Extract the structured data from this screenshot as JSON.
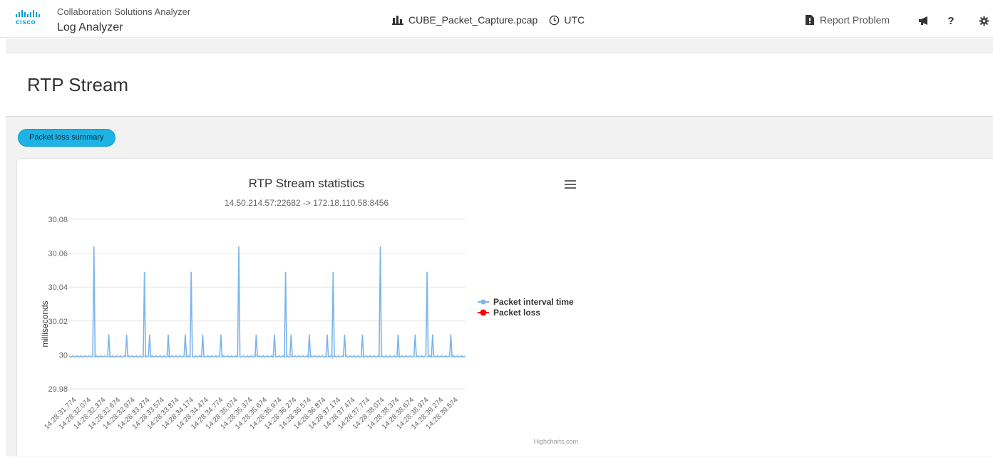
{
  "header": {
    "brand": "cisco",
    "app_title": "Collaboration Solutions Analyzer",
    "app_subtitle": "Log Analyzer",
    "file_name": "CUBE_Packet_Capture.pcap",
    "timezone": "UTC",
    "report_label": "Report Problem",
    "help_label": "?"
  },
  "page": {
    "title": "RTP Stream",
    "summary_button": "Packet loss summary"
  },
  "colors": {
    "accent": "#1fb3e5",
    "series_interval": "#7cb5ec",
    "series_loss": "#ff0000"
  },
  "icons": [
    "bar-chart-icon",
    "clock-icon",
    "report-icon",
    "megaphone-icon",
    "help-icon",
    "gear-icon",
    "menu-icon"
  ],
  "chart_data": {
    "type": "line",
    "title": "RTP Stream statistics",
    "subtitle": "14.50.214.57:22682 -> 172.18.110.58:8456",
    "ylabel": "milliseconds",
    "xlabel": "",
    "ylim": [
      29.98,
      30.08
    ],
    "yticks": [
      29.98,
      30,
      30.02,
      30.04,
      30.06,
      30.08
    ],
    "xticks": [
      "14:28:31.774",
      "14:28:32.074",
      "14:28:32.374",
      "14:28:32.674",
      "14:28:32.974",
      "14:28:33.274",
      "14:28:33.574",
      "14:28:33.874",
      "14:28:34.174",
      "14:28:34.474",
      "14:28:34.774",
      "14:28:35.074",
      "14:28:35.374",
      "14:28:35.674",
      "14:28:35.974",
      "14:28:36.274",
      "14:28:36.574",
      "14:28:36.874",
      "14:28:37.174",
      "14:28:37.474",
      "14:28:37.774",
      "14:28:38.074",
      "14:28:38.374",
      "14:28:38.674",
      "14:28:38.974",
      "14:28:39.274",
      "14:28:39.574"
    ],
    "grid": true,
    "legend_position": "right",
    "credit": "Highcharts.com",
    "series": [
      {
        "name": "Packet interval time",
        "baseline": 29.999,
        "spikes": [
          {
            "t": 0.0625,
            "v": 30.064
          },
          {
            "t": 0.1,
            "v": 30.012
          },
          {
            "t": 0.145,
            "v": 30.012
          },
          {
            "t": 0.19,
            "v": 30.049
          },
          {
            "t": 0.203,
            "v": 30.012
          },
          {
            "t": 0.25,
            "v": 30.012
          },
          {
            "t": 0.293,
            "v": 30.012
          },
          {
            "t": 0.308,
            "v": 30.049
          },
          {
            "t": 0.337,
            "v": 30.012
          },
          {
            "t": 0.383,
            "v": 30.012
          },
          {
            "t": 0.428,
            "v": 30.064
          },
          {
            "t": 0.472,
            "v": 30.012
          },
          {
            "t": 0.518,
            "v": 30.012
          },
          {
            "t": 0.546,
            "v": 30.049
          },
          {
            "t": 0.56,
            "v": 30.012
          },
          {
            "t": 0.606,
            "v": 30.012
          },
          {
            "t": 0.651,
            "v": 30.012
          },
          {
            "t": 0.666,
            "v": 30.049
          },
          {
            "t": 0.695,
            "v": 30.012
          },
          {
            "t": 0.74,
            "v": 30.012
          },
          {
            "t": 0.785,
            "v": 30.064
          },
          {
            "t": 0.83,
            "v": 30.012
          },
          {
            "t": 0.873,
            "v": 30.012
          },
          {
            "t": 0.903,
            "v": 30.049
          },
          {
            "t": 0.917,
            "v": 30.012
          },
          {
            "t": 0.963,
            "v": 30.012
          }
        ]
      },
      {
        "name": "Packet loss",
        "values": []
      }
    ]
  }
}
